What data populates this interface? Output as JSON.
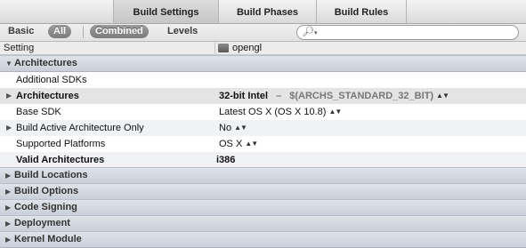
{
  "tabs": [
    {
      "label": "Build Settings",
      "selected": true
    },
    {
      "label": "Build Phases",
      "selected": false
    },
    {
      "label": "Build Rules",
      "selected": false
    }
  ],
  "filter": {
    "basic": "Basic",
    "all": "All",
    "combined": "Combined",
    "levels": "Levels",
    "search_placeholder": ""
  },
  "header": {
    "setting": "Setting",
    "target": "opengl"
  },
  "sections": {
    "architectures": "Architectures",
    "build_locations": "Build Locations",
    "build_options": "Build Options",
    "code_signing": "Code Signing",
    "deployment": "Deployment",
    "kernel_module": "Kernel Module"
  },
  "rows": {
    "additional_sdks": {
      "name": "Additional SDKs",
      "value": ""
    },
    "architectures": {
      "name": "Architectures",
      "value": "32-bit Intel",
      "dash": "–",
      "macro": "$(ARCHS_STANDARD_32_BIT)"
    },
    "base_sdk": {
      "name": "Base SDK",
      "value": "Latest OS X (OS X 10.8)"
    },
    "build_active": {
      "name": "Build Active Architecture Only",
      "value": "No"
    },
    "supported_platforms": {
      "name": "Supported Platforms",
      "value": "OS X"
    },
    "valid_architectures": {
      "name": "Valid Architectures",
      "value": "i386"
    }
  },
  "icons": {
    "stepper": "up-down-arrows",
    "disclosure": "triangle",
    "search": "magnifier",
    "target": "app-target"
  }
}
